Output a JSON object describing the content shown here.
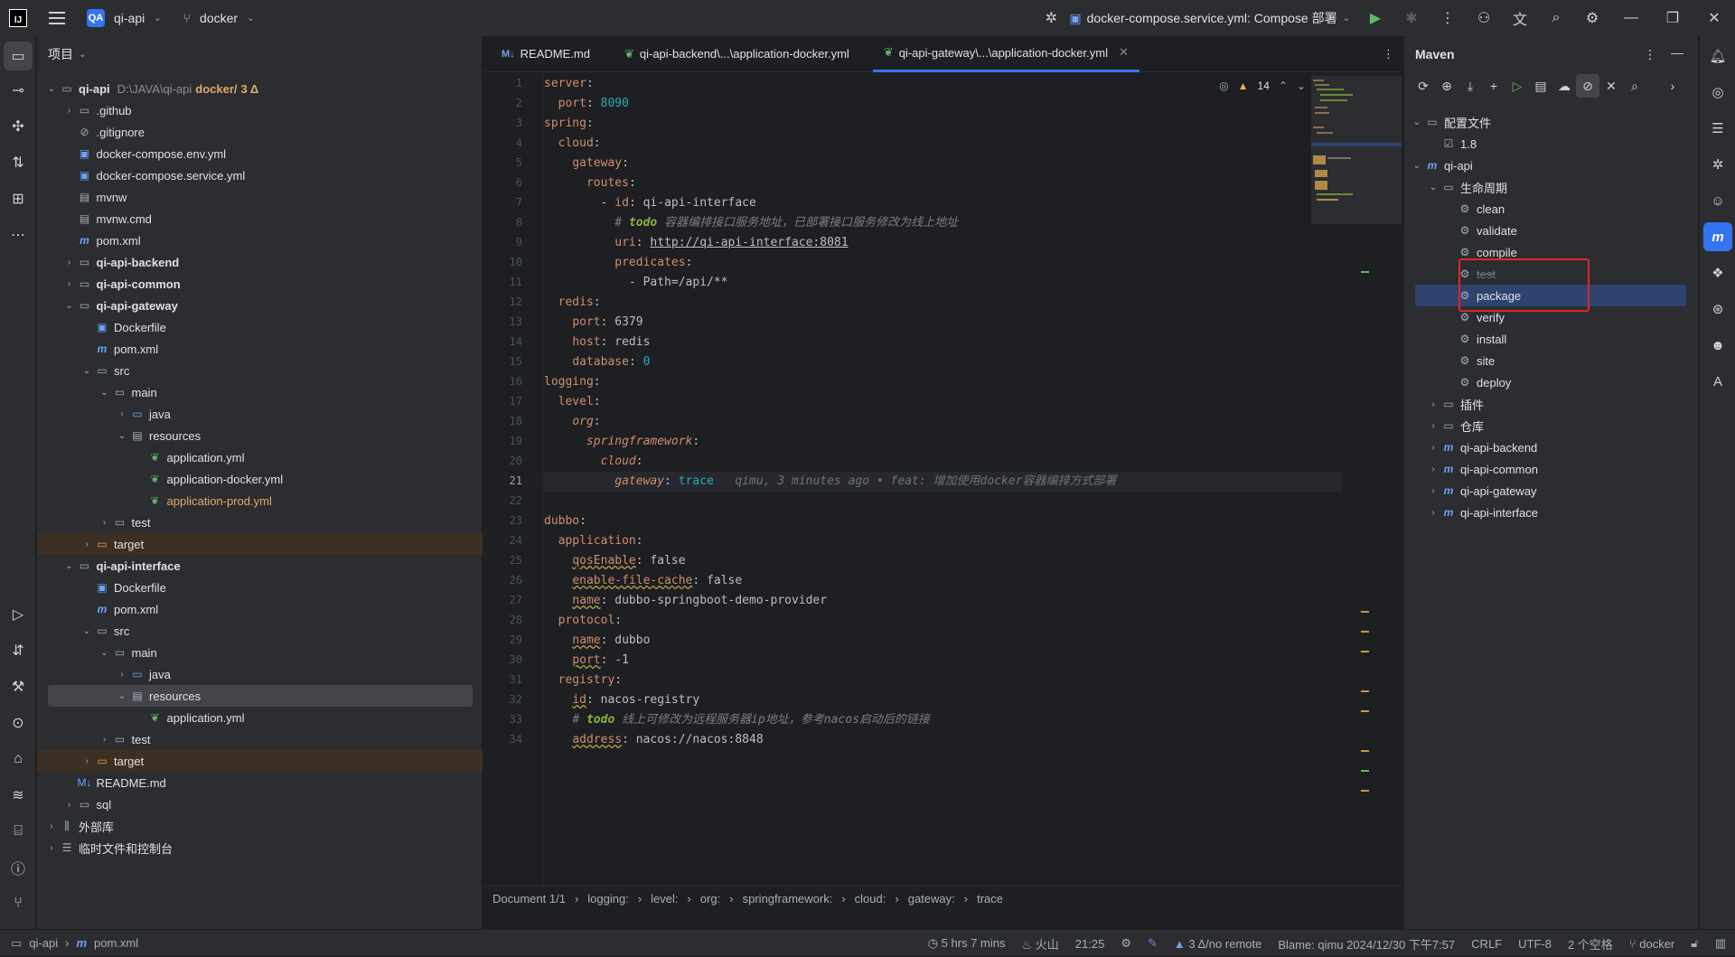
{
  "titlebar": {
    "project_badge": "QA",
    "project_name": "qi-api",
    "branch": "docker",
    "run_config": "docker-compose.service.yml: Compose 部署"
  },
  "project_panel": {
    "title": "项目",
    "root": {
      "name": "qi-api",
      "path": "D:\\JAVA\\qi-api",
      "branch": "docker/",
      "changes": "3 Δ"
    },
    "items": [
      {
        "label": ".github",
        "icon": "folder-icon"
      },
      {
        "label": ".gitignore",
        "icon": "ignore-icon"
      },
      {
        "label": "docker-compose.env.yml",
        "icon": "docker-icon"
      },
      {
        "label": "docker-compose.service.yml",
        "icon": "docker-icon"
      },
      {
        "label": "mvnw",
        "icon": "terminal-icon"
      },
      {
        "label": "mvnw.cmd",
        "icon": "terminal-icon"
      },
      {
        "label": "pom.xml",
        "icon": "maven-icon"
      },
      {
        "label": "qi-api-backend",
        "icon": "module-icon"
      },
      {
        "label": "qi-api-common",
        "icon": "module-icon"
      },
      {
        "label": "qi-api-gateway",
        "icon": "module-icon"
      },
      {
        "label": "Dockerfile",
        "icon": "docker-icon"
      },
      {
        "label": "pom.xml",
        "icon": "maven-icon"
      },
      {
        "label": "src",
        "icon": "folder-icon"
      },
      {
        "label": "main",
        "icon": "folder-icon"
      },
      {
        "label": "java",
        "icon": "source-folder-icon"
      },
      {
        "label": "resources",
        "icon": "resources-folder-icon"
      },
      {
        "label": "application.yml",
        "icon": "spring-yml-icon"
      },
      {
        "label": "application-docker.yml",
        "icon": "spring-yml-icon"
      },
      {
        "label": "application-prod.yml",
        "icon": "spring-yml-icon"
      },
      {
        "label": "test",
        "icon": "folder-icon"
      },
      {
        "label": "target",
        "icon": "excluded-folder-icon"
      },
      {
        "label": "qi-api-interface",
        "icon": "module-icon"
      },
      {
        "label": "Dockerfile",
        "icon": "docker-icon"
      },
      {
        "label": "pom.xml",
        "icon": "maven-icon"
      },
      {
        "label": "src",
        "icon": "folder-icon"
      },
      {
        "label": "main",
        "icon": "folder-icon"
      },
      {
        "label": "java",
        "icon": "source-folder-icon"
      },
      {
        "label": "resources",
        "icon": "resources-folder-icon"
      },
      {
        "label": "application.yml",
        "icon": "spring-yml-icon"
      },
      {
        "label": "test",
        "icon": "folder-icon"
      },
      {
        "label": "target",
        "icon": "excluded-folder-icon"
      },
      {
        "label": "README.md",
        "icon": "markdown-icon"
      },
      {
        "label": "sql",
        "icon": "folder-icon"
      },
      {
        "label": "外部库",
        "icon": "library-icon"
      },
      {
        "label": "临时文件和控制台",
        "icon": "scratch-icon"
      }
    ]
  },
  "editor": {
    "tabs": [
      {
        "label": "README.md"
      },
      {
        "label": "qi-api-backend\\...\\application-docker.yml"
      },
      {
        "label": "qi-api-gateway\\...\\application-docker.yml"
      }
    ],
    "warning_count": "14",
    "line_numbers": [
      "1",
      "2",
      "3",
      "4",
      "5",
      "6",
      "7",
      "8",
      "9",
      "10",
      "11",
      "12",
      "13",
      "14",
      "15",
      "16",
      "17",
      "18",
      "19",
      "20",
      "21",
      "22",
      "23",
      "24",
      "25",
      "26",
      "27",
      "28",
      "29",
      "30",
      "31",
      "32",
      "33",
      "34"
    ],
    "code": {
      "l1_key": "server",
      "l1_colon": ":",
      "l2_key": "port",
      "l2_colon": ": ",
      "l2_val": "8090",
      "l3_key": "spring",
      "l3_colon": ":",
      "l4_key": "cloud",
      "l4_colon": ":",
      "l5_key": "gateway",
      "l5_colon": ":",
      "l6_key": "routes",
      "l6_colon": ":",
      "l7_dash": "- ",
      "l7_key": "id",
      "l7_colon": ": ",
      "l7_val": "qi-api-interface",
      "l8_hash": "# ",
      "l8_todo": "todo",
      "l8_text": " 容器编排接口服务地址，已部署接口服务修改为线上地址",
      "l9_key": "uri",
      "l9_colon": ": ",
      "l9_val": "http://qi-api-interface:8081",
      "l10_key": "predicates",
      "l10_colon": ":",
      "l11_val": "- Path=/api/**",
      "l12_key": "redis",
      "l12_colon": ":",
      "l13_key": "port",
      "l13_colon": ": ",
      "l13_val": "6379",
      "l14_key": "host",
      "l14_colon": ": ",
      "l14_val": "redis",
      "l15_key": "database",
      "l15_colon": ": ",
      "l15_val": "0",
      "l16_key": "logging",
      "l16_colon": ":",
      "l17_key": "level",
      "l17_colon": ":",
      "l18_key": "org",
      "l18_colon": ":",
      "l19_key": "springframework",
      "l19_colon": ":",
      "l20_key": "cloud",
      "l20_colon": ":",
      "l21_key": "gateway",
      "l21_colon": ": ",
      "l21_val": "trace",
      "l21_blame": "qimu, 3 minutes ago • feat: 增加使用docker容器编排方式部署",
      "l23_key": "dubbo",
      "l23_colon": ":",
      "l24_key": "application",
      "l24_colon": ":",
      "l25_key": "qosEnable",
      "l25_colon": ": ",
      "l25_val": "false",
      "l26_key": "enable-file-cache",
      "l26_colon": ": ",
      "l26_val": "false",
      "l27_key": "name",
      "l27_colon": ": ",
      "l27_val": "dubbo-springboot-demo-provider",
      "l28_key": "protocol",
      "l28_colon": ":",
      "l29_key": "name",
      "l29_colon": ": ",
      "l29_val": "dubbo",
      "l30_key": "port",
      "l30_colon": ": ",
      "l30_val": "-1",
      "l31_key": "registry",
      "l31_colon": ":",
      "l32_key": "id",
      "l32_colon": ": ",
      "l32_val": "nacos-registry",
      "l33_hash": "# ",
      "l33_todo": "todo",
      "l33_text": " 线上可修改为远程服务器ip地址，参考nacos启动后的链接",
      "l34_key": "address",
      "l34_colon": ": ",
      "l34_val": "nacos://nacos:8848"
    },
    "breadcrumb": [
      "Document 1/1",
      "logging:",
      "level:",
      "org:",
      "springframework:",
      "cloud:",
      "gateway:",
      "trace"
    ]
  },
  "maven": {
    "title": "Maven",
    "tree": [
      {
        "label": "配置文件"
      },
      {
        "label": "1.8"
      },
      {
        "label": "qi-api"
      },
      {
        "label": "生命周期"
      },
      {
        "label": "clean"
      },
      {
        "label": "validate"
      },
      {
        "label": "compile"
      },
      {
        "label": "test"
      },
      {
        "label": "package"
      },
      {
        "label": "verify"
      },
      {
        "label": "install"
      },
      {
        "label": "site"
      },
      {
        "label": "deploy"
      },
      {
        "label": "插件"
      },
      {
        "label": "仓库"
      },
      {
        "label": "qi-api-backend"
      },
      {
        "label": "qi-api-common"
      },
      {
        "label": "qi-api-gateway"
      },
      {
        "label": "qi-api-interface"
      }
    ]
  },
  "statusbar": {
    "crumb_project": "qi-api",
    "crumb_file": "pom.xml",
    "time_spent": "5 hrs 7 mins",
    "engine": "火山",
    "position": "21:25",
    "vcs": "3 Δ/no remote",
    "blame": "Blame: qimu 2024/12/30 下午7:57",
    "line_ending": "CRLF",
    "encoding": "UTF-8",
    "indent": "2 个空格",
    "branch": "docker"
  },
  "colors": {
    "accent": "#3574f0",
    "selection": "#2e436e",
    "highlight_box": "#e0262a"
  }
}
